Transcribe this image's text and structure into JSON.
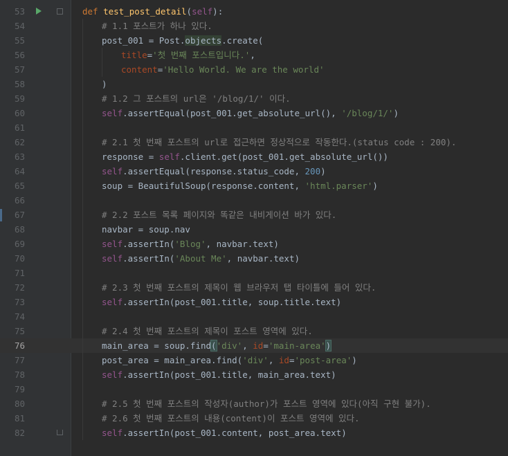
{
  "editor": {
    "current_line": "76",
    "run_line": "53",
    "lines": [
      {
        "n": "53",
        "indent": 0,
        "parts": [
          [
            "kw",
            "def "
          ],
          [
            "fn",
            "test_post_detail"
          ],
          [
            "p",
            "("
          ],
          [
            "self",
            "self"
          ],
          [
            "p",
            "):"
          ]
        ]
      },
      {
        "n": "54",
        "indent": 1,
        "parts": [
          [
            "cmt",
            "# 1.1 포스트가 하나 있다."
          ]
        ]
      },
      {
        "n": "55",
        "indent": 1,
        "parts": [
          [
            "p",
            "post_001 = Post."
          ],
          [
            "hl",
            "objects"
          ],
          [
            "p",
            ".create("
          ]
        ]
      },
      {
        "n": "56",
        "indent": 2,
        "parts": [
          [
            "kwarg",
            "title"
          ],
          [
            "p",
            "="
          ],
          [
            "str",
            "'첫 번째 포스트입니다.'"
          ],
          [
            "p",
            ","
          ]
        ]
      },
      {
        "n": "57",
        "indent": 2,
        "parts": [
          [
            "kwarg",
            "content"
          ],
          [
            "p",
            "="
          ],
          [
            "str",
            "'Hello World. We are the world'"
          ]
        ]
      },
      {
        "n": "58",
        "indent": 1,
        "parts": [
          [
            "p",
            ")"
          ]
        ]
      },
      {
        "n": "59",
        "indent": 1,
        "parts": [
          [
            "cmt",
            "# 1.2 그 포스트의 url은 '/blog/1/' 이다."
          ]
        ]
      },
      {
        "n": "60",
        "indent": 1,
        "parts": [
          [
            "self",
            "self"
          ],
          [
            "p",
            ".assertEqual(post_001.get_absolute_url(), "
          ],
          [
            "str",
            "'/blog/1/'"
          ],
          [
            "p",
            ")"
          ]
        ]
      },
      {
        "n": "61",
        "indent": 1,
        "parts": []
      },
      {
        "n": "62",
        "indent": 1,
        "parts": [
          [
            "cmt",
            "# 2.1 첫 번째 포스트의 url로 접근하면 정상적으로 작동한다.(status code : 200)."
          ]
        ]
      },
      {
        "n": "63",
        "indent": 1,
        "parts": [
          [
            "p",
            "response = "
          ],
          [
            "self",
            "self"
          ],
          [
            "p",
            ".client.get(post_001.get_absolute_url())"
          ]
        ]
      },
      {
        "n": "64",
        "indent": 1,
        "parts": [
          [
            "self",
            "self"
          ],
          [
            "p",
            ".assertEqual(response.status_code, "
          ],
          [
            "num",
            "200"
          ],
          [
            "p",
            ")"
          ]
        ]
      },
      {
        "n": "65",
        "indent": 1,
        "parts": [
          [
            "p",
            "soup = BeautifulSoup(response.content, "
          ],
          [
            "str",
            "'html.parser'"
          ],
          [
            "p",
            ")"
          ]
        ]
      },
      {
        "n": "66",
        "indent": 1,
        "parts": []
      },
      {
        "n": "67",
        "indent": 1,
        "parts": [
          [
            "cmt",
            "# 2.2 포스트 목록 페이지와 똑같은 내비게이션 바가 있다."
          ]
        ]
      },
      {
        "n": "68",
        "indent": 1,
        "parts": [
          [
            "p",
            "navbar = soup.nav"
          ]
        ]
      },
      {
        "n": "69",
        "indent": 1,
        "parts": [
          [
            "self",
            "self"
          ],
          [
            "p",
            ".assertIn("
          ],
          [
            "str",
            "'Blog'"
          ],
          [
            "p",
            ", navbar.text)"
          ]
        ]
      },
      {
        "n": "70",
        "indent": 1,
        "parts": [
          [
            "self",
            "self"
          ],
          [
            "p",
            ".assertIn("
          ],
          [
            "str",
            "'About Me'"
          ],
          [
            "p",
            ", navbar.text)"
          ]
        ]
      },
      {
        "n": "71",
        "indent": 1,
        "parts": []
      },
      {
        "n": "72",
        "indent": 1,
        "parts": [
          [
            "cmt",
            "# 2.3 첫 번째 포스트의 제목이 웹 브라우저 탭 타이틀에 들어 있다."
          ]
        ]
      },
      {
        "n": "73",
        "indent": 1,
        "parts": [
          [
            "self",
            "self"
          ],
          [
            "p",
            ".assertIn(post_001.title, soup.title.text)"
          ]
        ]
      },
      {
        "n": "74",
        "indent": 1,
        "parts": []
      },
      {
        "n": "75",
        "indent": 1,
        "parts": [
          [
            "cmt",
            "# 2.4 첫 번째 포스트의 제목이 포스트 영역에 있다."
          ]
        ]
      },
      {
        "n": "76",
        "indent": 1,
        "parts": [
          [
            "p",
            "main_area = soup.find"
          ],
          [
            "brace",
            "("
          ],
          [
            "str",
            "'div'"
          ],
          [
            "p",
            ", "
          ],
          [
            "kwarg",
            "id"
          ],
          [
            "p",
            "="
          ],
          [
            "str",
            "'main-area'"
          ],
          [
            "brace",
            ")"
          ],
          [
            "cursor",
            ""
          ]
        ]
      },
      {
        "n": "77",
        "indent": 1,
        "parts": [
          [
            "p",
            "post_area = main_area.find("
          ],
          [
            "str",
            "'div'"
          ],
          [
            "p",
            ", "
          ],
          [
            "kwarg",
            "id"
          ],
          [
            "p",
            "="
          ],
          [
            "str",
            "'post-area'"
          ],
          [
            "p",
            ")"
          ]
        ]
      },
      {
        "n": "78",
        "indent": 1,
        "parts": [
          [
            "self",
            "self"
          ],
          [
            "p",
            ".assertIn(post_001.title, main_area.text)"
          ]
        ]
      },
      {
        "n": "79",
        "indent": 1,
        "parts": []
      },
      {
        "n": "80",
        "indent": 1,
        "parts": [
          [
            "cmt",
            "# 2.5 첫 번째 포스트의 작성자(author)가 포스트 영역에 있다(아직 구현 불가)."
          ]
        ]
      },
      {
        "n": "81",
        "indent": 1,
        "parts": [
          [
            "cmt",
            "# 2.6 첫 번째 포스트의 내용(content)이 포스트 영역에 있다."
          ]
        ]
      },
      {
        "n": "82",
        "indent": 1,
        "parts": [
          [
            "self",
            "self"
          ],
          [
            "p",
            ".assertIn(post_001.content, post_area.text"
          ],
          [
            "p",
            ")"
          ]
        ]
      }
    ]
  }
}
